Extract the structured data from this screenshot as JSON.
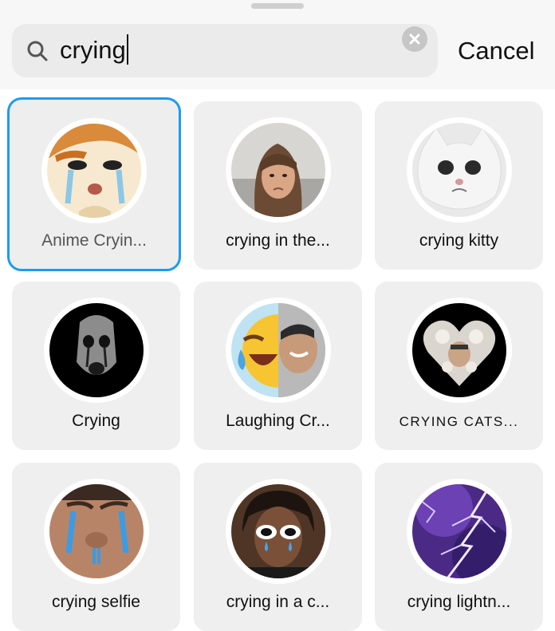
{
  "search": {
    "query": "crying",
    "cancel_label": "Cancel"
  },
  "results": [
    {
      "label": "Anime Cryin...",
      "selected": true
    },
    {
      "label": "crying in the..."
    },
    {
      "label": "crying kitty"
    },
    {
      "label": "Crying"
    },
    {
      "label": "Laughing Cr..."
    },
    {
      "label": "CRYING CATS..."
    },
    {
      "label": "crying selfie"
    },
    {
      "label": "crying in a c..."
    },
    {
      "label": "crying lightn..."
    }
  ],
  "colors": {
    "selection_border": "#1d9bf0",
    "card_bg": "#efefef"
  }
}
